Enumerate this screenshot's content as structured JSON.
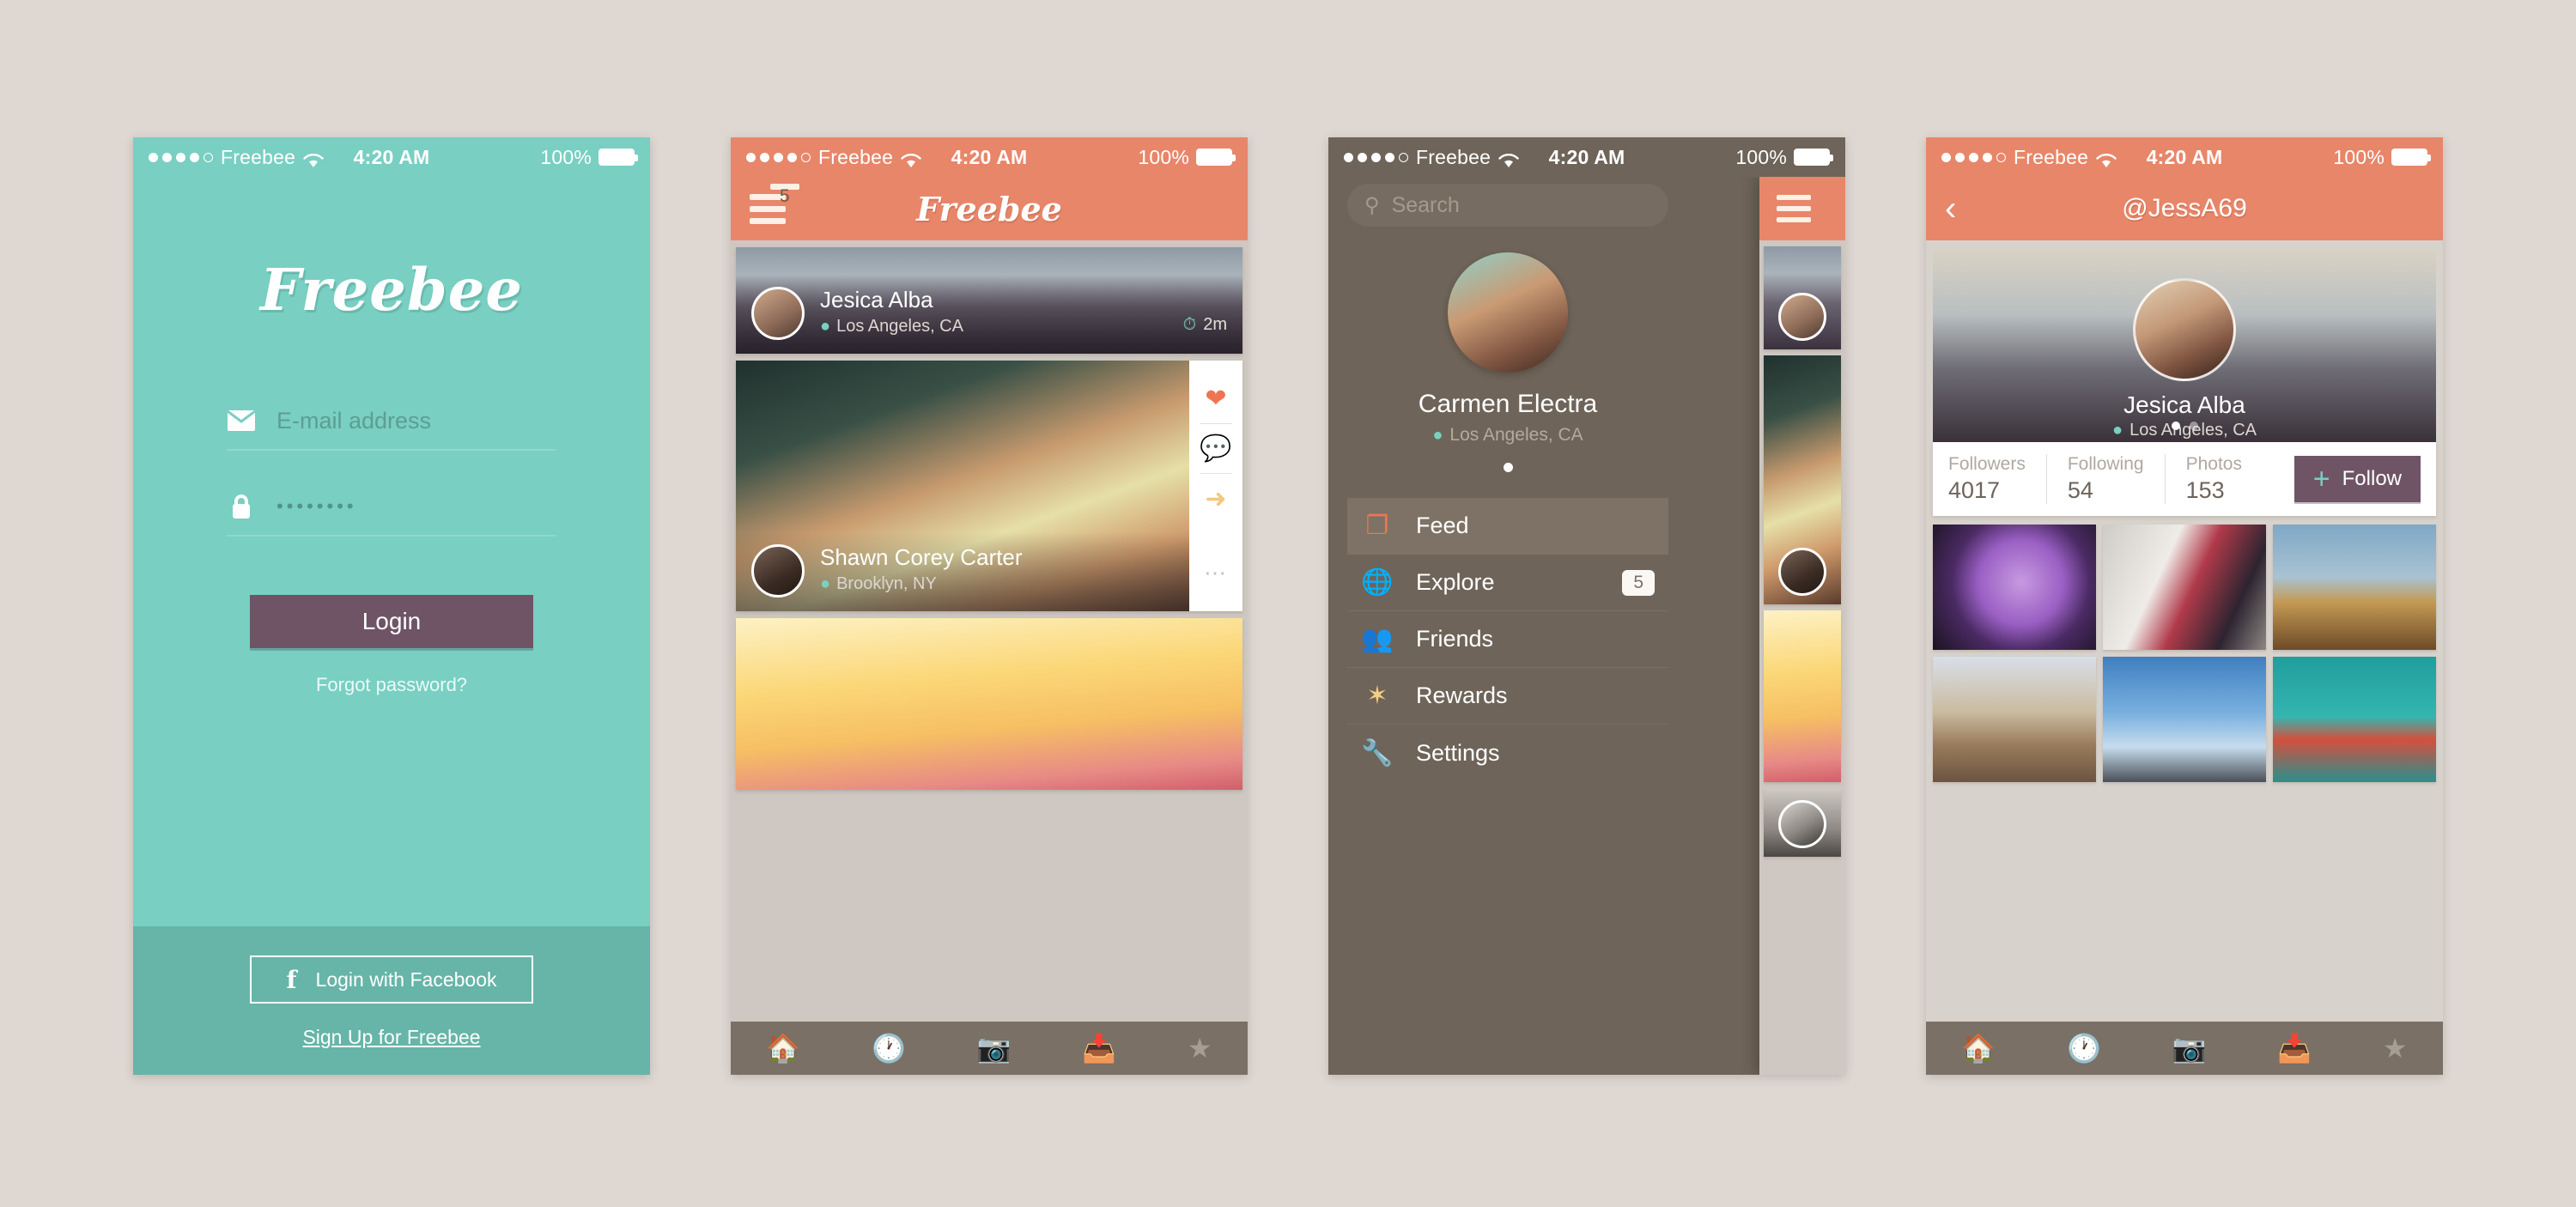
{
  "statusbar": {
    "carrier": "Freebee",
    "time": "4:20 AM",
    "battery_percent": "100%",
    "wifi_icon": "wifi-icon",
    "signal_icon": "signal-dots-icon",
    "battery_icon": "battery-icon"
  },
  "colors": {
    "page_background": "#ded7d2",
    "teal": "#79cfc2",
    "teal_dark": "#66b5a8",
    "coral": "#e8866a",
    "coral_icon": "#ef7452",
    "plum": "#6f5466",
    "taupe": "#6e6459",
    "tabbar": "#7a7065",
    "badge_cream": "#f6dfb4",
    "purple": "#b092cf",
    "gold": "#f4cf84"
  },
  "screen_login": {
    "logo": "Freebee",
    "email": {
      "placeholder": "E-mail address",
      "value": "",
      "icon": "envelope-icon"
    },
    "password": {
      "value": "••••••••",
      "icon": "lock-icon"
    },
    "login_button": "Login",
    "forgot_link": "Forgot password?",
    "facebook_button": "Login with Facebook",
    "facebook_glyph": "f",
    "signup_link": "Sign Up for Freebee"
  },
  "screen_feed": {
    "nav_title": "Freebee",
    "menu_badge": "5",
    "menu_icon": "hamburger-icon",
    "posts": [
      {
        "name": "Jesica Alba",
        "location": "Los Angeles, CA",
        "time": "2m",
        "photo": "beach-sunset-photo",
        "avatar": "jesica-avatar"
      },
      {
        "name": "Shawn Corey Carter",
        "location": "Brooklyn, NY",
        "time": "",
        "photo": "bridge-steel-photo",
        "avatar": "shawn-avatar"
      },
      {
        "name": "",
        "location": "",
        "time": "",
        "photo": "raspberries-photo",
        "avatar": ""
      }
    ],
    "actions": {
      "like": "heart-icon",
      "comment": "comment-icon",
      "share": "share-arrow-icon",
      "more": "more-dots-icon"
    },
    "tabs": [
      {
        "icon": "home-icon",
        "active": true
      },
      {
        "icon": "clock-icon",
        "active": false
      },
      {
        "icon": "camera-icon",
        "active": false
      },
      {
        "icon": "inbox-icon",
        "active": false
      },
      {
        "icon": "star-icon",
        "active": false
      }
    ]
  },
  "screen_menu": {
    "search_placeholder": "Search",
    "search_icon": "search-icon",
    "profile": {
      "name": "Carmen Electra",
      "location": "Los Angeles, CA",
      "avatar": "carmen-avatar",
      "page_dots": 1,
      "active_dot": 0
    },
    "items": [
      {
        "label": "Feed",
        "icon": "layers-icon",
        "badge": "",
        "active": true
      },
      {
        "label": "Explore",
        "icon": "globe-icon",
        "badge": "5",
        "active": false
      },
      {
        "label": "Friends",
        "icon": "people-icon",
        "badge": "",
        "active": false
      },
      {
        "label": "Rewards",
        "icon": "burst-icon",
        "badge": "",
        "active": false
      },
      {
        "label": "Settings",
        "icon": "wrench-icon",
        "badge": "",
        "active": false
      }
    ]
  },
  "screen_profile": {
    "nav_title": "@JessA69",
    "back_icon": "chevron-left-icon",
    "name": "Jesica Alba",
    "location": "Los Angeles, CA",
    "hero_photo": "beach-sunset-photo",
    "avatar": "jesica-avatar",
    "page_dots": 2,
    "active_dot": 0,
    "stats": [
      {
        "label": "Followers",
        "value": "4017"
      },
      {
        "label": "Following",
        "value": "54"
      },
      {
        "label": "Photos",
        "value": "153"
      }
    ],
    "follow_button": "Follow",
    "follow_icon": "plus-icon",
    "photos": [
      "purple-flower-photo",
      "red-tricycle-photo",
      "golden-hills-photo",
      "coastal-railway-photo",
      "city-skyline-photo",
      "red-boat-photo"
    ],
    "tabs": [
      {
        "icon": "home-icon",
        "active": false
      },
      {
        "icon": "clock-icon",
        "active": false
      },
      {
        "icon": "camera-icon",
        "active": false
      },
      {
        "icon": "inbox-icon",
        "active": false
      },
      {
        "icon": "star-icon",
        "active": false
      }
    ]
  }
}
